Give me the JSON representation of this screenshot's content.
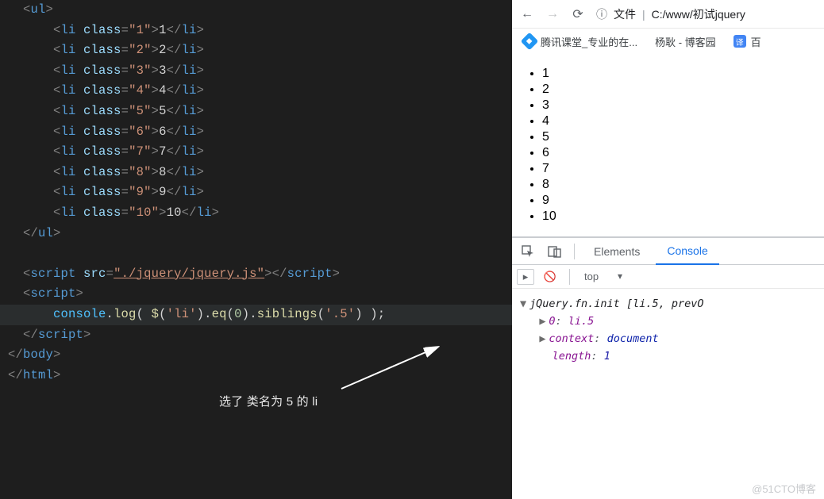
{
  "editor": {
    "ul_open": "<ul>",
    "lis": [
      {
        "cls": "1",
        "txt": "1"
      },
      {
        "cls": "2",
        "txt": "2"
      },
      {
        "cls": "3",
        "txt": "3"
      },
      {
        "cls": "4",
        "txt": "4"
      },
      {
        "cls": "5",
        "txt": "5"
      },
      {
        "cls": "6",
        "txt": "6"
      },
      {
        "cls": "7",
        "txt": "7"
      },
      {
        "cls": "8",
        "txt": "8"
      },
      {
        "cls": "9",
        "txt": "9"
      },
      {
        "cls": "10",
        "txt": "10"
      }
    ],
    "ul_close": "</ul>",
    "script_src": "./jquery/jquery.js",
    "console": "console",
    "log": "log",
    "jq": "$",
    "sel": "'li'",
    "eq": "eq",
    "eq_arg": "0",
    "siblings": "siblings",
    "sib_arg": "'.5'",
    "body_close": "</body>",
    "html_close": "</html>",
    "annotation": "选了 类名为 5 的 li"
  },
  "browser": {
    "file_label": "文件",
    "url": "C:/www/初试jquery",
    "bookmarks": [
      {
        "label": "腾讯课堂_专业的在...",
        "icon": "blue-diamond"
      },
      {
        "label": "杨耿 - 博客园",
        "icon": "none"
      },
      {
        "label": "百",
        "icon": "translate"
      }
    ],
    "list": [
      "1",
      "2",
      "3",
      "4",
      "5",
      "6",
      "7",
      "8",
      "9",
      "10"
    ]
  },
  "devtools": {
    "tabs": {
      "elements": "Elements",
      "console": "Console"
    },
    "context": "top",
    "output": {
      "header": "jQuery.fn.init",
      "preview": "[li.5, prevO",
      "expand0_key": "0",
      "expand0_val": "li.5",
      "context_key": "context",
      "context_val": "document",
      "length_key": "length",
      "length_val": "1"
    }
  },
  "watermark": "@51CTO博客"
}
